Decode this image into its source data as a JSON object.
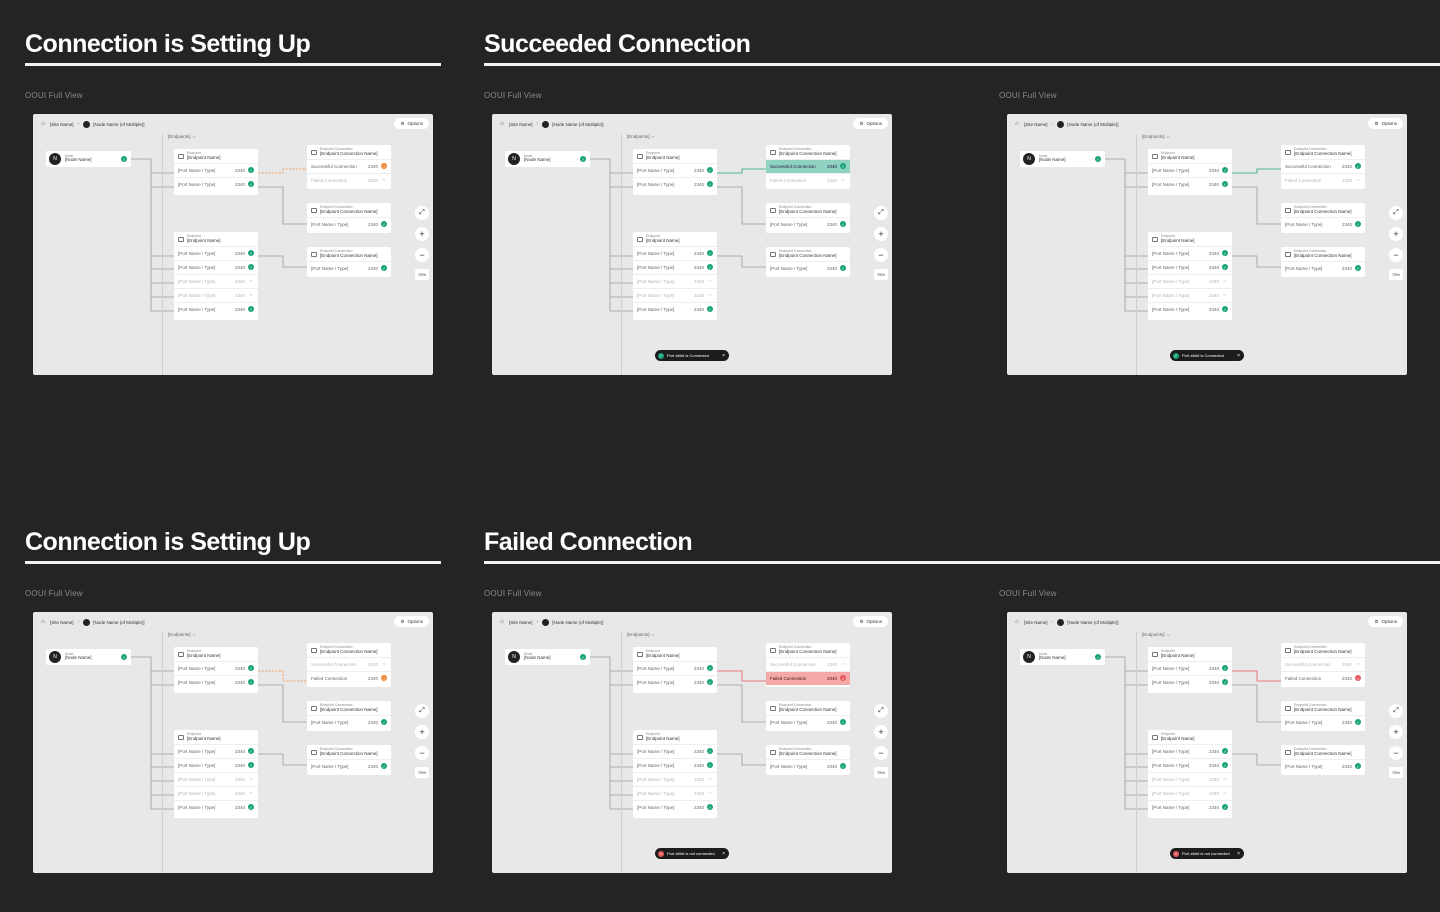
{
  "sections": [
    {
      "title": "Connection is Setting Up"
    },
    {
      "title": "Succeeded Connection"
    },
    {
      "title": "Connection is Setting Up"
    },
    {
      "title": "Failed Connection"
    }
  ],
  "view_label": "OOUI Full View",
  "breadcrumb": {
    "site": "[Site Name]",
    "node": "[Node Name (of Multiple)]"
  },
  "options_label": "Options",
  "endpoints_label": "[Endpoints]",
  "node": {
    "label": "Node",
    "name": "[Node Name]",
    "initial": "N"
  },
  "endpoint": {
    "label": "Endpoint",
    "name": "[Endpoint Name]"
  },
  "connection": {
    "label": "Endpoint Connection",
    "name": "[Endpoint Connection Name]"
  },
  "port_row": {
    "name": "[Port Name / Type]",
    "num": "2340"
  },
  "successful_connection": "Successful Connection",
  "failed_connection": "Failed Connection",
  "zoom": {
    "level": "75%"
  },
  "toast_connected": "Port #### is Connected",
  "toast_failed": "Port #### is not connected",
  "colors": {
    "ok": "#1aa37a",
    "warn": "#f08a3a",
    "err": "#e85a5a",
    "success_hl": "#8fd2bf",
    "failed_hl": "#f5a8a8"
  },
  "frames": [
    {
      "state": "setting-up",
      "toast": ""
    },
    {
      "state": "succeeded-highlight",
      "toast": "connected"
    },
    {
      "state": "succeeded",
      "toast": "connected"
    },
    {
      "state": "setting-up-2",
      "toast": ""
    },
    {
      "state": "failed-highlight",
      "toast": "failed"
    },
    {
      "state": "failed",
      "toast": "failed"
    }
  ]
}
